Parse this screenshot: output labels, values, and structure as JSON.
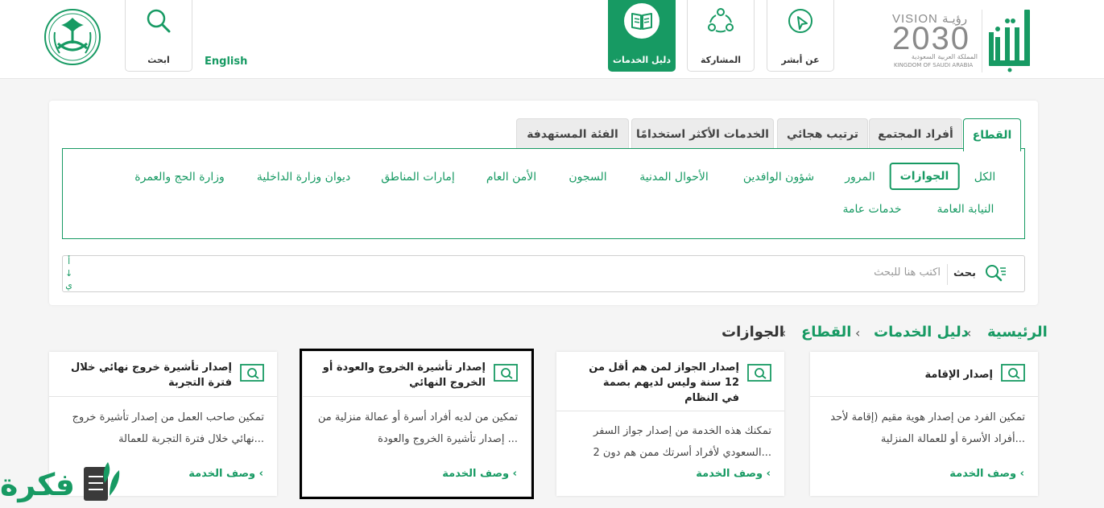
{
  "header": {
    "brand": {
      "logo_text": "أبشر",
      "vision_text": "VISION رؤيـة",
      "vision_year": "2030",
      "kingdom_ar": "المملكة العربية السعودية",
      "kingdom_en": "KINGDOM OF SAUDI ARABIA"
    },
    "nav": [
      {
        "label": "عن أبشر",
        "icon": "cursor-pointer-icon",
        "active": false
      },
      {
        "label": "المشاركة",
        "icon": "share-network-icon",
        "active": false
      },
      {
        "label": "دليل الخدمات",
        "icon": "book-icon",
        "active": true
      }
    ],
    "search_button": {
      "label": "ابحث",
      "icon": "search-icon"
    },
    "language_link": "English",
    "emblem_icon": "saudi-emblem-icon"
  },
  "tabs": [
    {
      "label": "القطاع",
      "active": true
    },
    {
      "label": "أفراد المجتمع",
      "active": false
    },
    {
      "label": "ترتيب هجائي",
      "active": false
    },
    {
      "label": "الخدمات الأكثر استخدامًا",
      "active": false
    },
    {
      "label": "الفئة المستهدفة",
      "active": false
    }
  ],
  "categories": [
    {
      "label": "الكل",
      "active": false
    },
    {
      "label": "الجوازات",
      "active": true
    },
    {
      "label": "المرور",
      "active": false
    },
    {
      "label": "شؤون الوافدين",
      "active": false
    },
    {
      "label": "الأحوال المدنية",
      "active": false
    },
    {
      "label": "السجون",
      "active": false
    },
    {
      "label": "الأمن العام",
      "active": false
    },
    {
      "label": "إمارات المناطق",
      "active": false
    },
    {
      "label": "ديوان وزارة الداخلية",
      "active": false
    },
    {
      "label": "وزارة الحج والعمرة",
      "active": false
    },
    {
      "label": "النيابة العامة",
      "active": false
    },
    {
      "label": "خدمات عامة",
      "active": false
    }
  ],
  "search": {
    "label": "بحث",
    "placeholder": "اكتب هنا للبحث",
    "side_marks": [
      "أ",
      "↓",
      "ي"
    ]
  },
  "breadcrumb": [
    {
      "label": "الرئيسية",
      "current": false
    },
    {
      "label": "دليل الخدمات",
      "current": false
    },
    {
      "label": "القطاع",
      "current": false
    },
    {
      "label": "الجوازات",
      "current": true
    }
  ],
  "service_cards": [
    {
      "title": "إصدار الإقامة",
      "description": "تمكين الفرد من إصدار هوية مقيم (إقامة لأحد أفراد الأسرة أو للعمالة المنزلية...",
      "link": "وصف الخدمة ‹",
      "selected": false
    },
    {
      "title": "إصدار الجواز لمن هم أقل من 12 سنة وليس لديهم بصمة في النظام",
      "description": "تمكنك هذه الخدمة من إصدار جواز السفر السعودي لأفراد أسرتك ممن هم دون 2...",
      "link": "وصف الخدمة ‹",
      "selected": false
    },
    {
      "title": "إصدار تأشيرة الخروج والعودة أو الخروج النهائي",
      "description": "تمكين من لديه أفراد أسرة أو عمالة منزلية من إصدار تأشيرة الخروج والعودة ...",
      "link": "وصف الخدمة ‹",
      "selected": true
    },
    {
      "title": "إصدار تأشيرة خروج نهائي خلال فترة التجربة",
      "description": "تمكين صاحب العمل من إصدار تأشيرة خروج نهائي خلال فترة التجربة للعمالة...",
      "link": "وصف الخدمة ‹",
      "selected": false
    }
  ],
  "watermark": {
    "text": "فكرة"
  },
  "colors": {
    "accent": "#179a63",
    "selected_outline": "#000000"
  }
}
